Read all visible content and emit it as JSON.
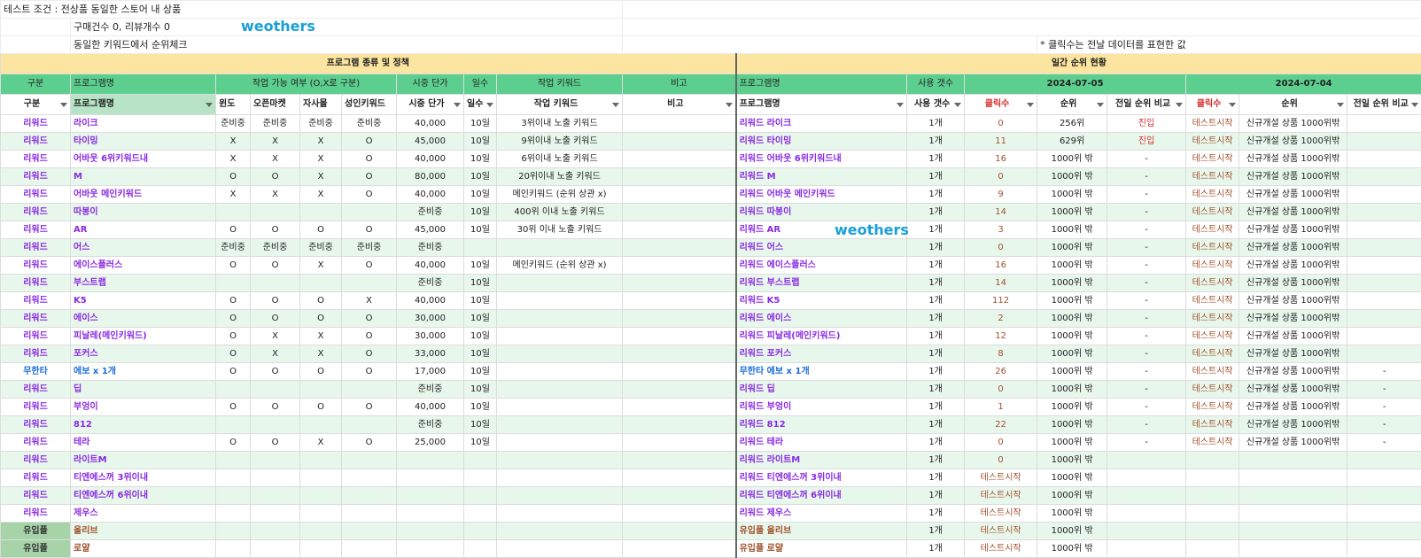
{
  "intro": {
    "line1": "테스트 조건 : 전상품 동일한 스토어 내 상품",
    "line2": "구매건수 0, 리뷰개수 0",
    "line3": "동일한 키워드에서 순위체크",
    "note": "* 클릭수는 전날 데이터를 표현한 값"
  },
  "watermark": "weothers",
  "sections": {
    "left": "프로그램 종류 및 정책",
    "right": "일간 순위 현황"
  },
  "header1": {
    "cat": "구분",
    "name": "프로그램명",
    "avail": "작업 가능 여부 (O,X로 구분)",
    "price": "시중 단가",
    "days": "일수",
    "kw": "작업 키워드",
    "memo": "비고",
    "rname": "프로그램명",
    "count": "사용 갯수",
    "date1": "2024-07-05",
    "date2": "2024-07-04"
  },
  "header2": {
    "cat": "구분",
    "name": "프로그램명",
    "wind": "윈도",
    "open": "오픈마켓",
    "own": "자사몰",
    "adult": "성인키워드",
    "price": "시중 단가",
    "days": "일수",
    "kw": "작업 키워드",
    "memo": "비고",
    "rname": "프로그램명",
    "count": "사용 갯수",
    "clicks1": "클릭수",
    "rank1": "순위",
    "cmp1": "전일 순위 비교",
    "clicks2": "클릭수",
    "rank2": "순위",
    "cmp2": "전일 순위 비교"
  },
  "rows": [
    {
      "cat": "리워드",
      "name": "라이크",
      "w": "준비중",
      "o": "준비중",
      "s": "준비중",
      "a": "준비중",
      "price": "40,000",
      "days": "10일",
      "kw": "3위이내 노출 키워드",
      "memo": "",
      "rname": "리워드 라이크",
      "count": "1개",
      "clicks": "0",
      "rank": "256위",
      "cmp": "진입",
      "c2": "테스트시작",
      "r2": "신규개설 상품 1000위밖",
      "p2": ""
    },
    {
      "cat": "리워드",
      "name": "타이밍",
      "w": "X",
      "o": "X",
      "s": "X",
      "a": "O",
      "price": "45,000",
      "days": "10일",
      "kw": "9위이내 노출 키워드",
      "memo": "",
      "rname": "리워드 타이밍",
      "count": "1개",
      "clicks": "11",
      "rank": "629위",
      "cmp": "진입",
      "c2": "테스트시작",
      "r2": "신규개설 상품 1000위밖",
      "p2": ""
    },
    {
      "cat": "리워드",
      "name": "어바웃 6위키워드내",
      "w": "X",
      "o": "X",
      "s": "X",
      "a": "O",
      "price": "40,000",
      "days": "10일",
      "kw": "6위이내 노출 키워드",
      "memo": "",
      "rname": "리워드 어바웃 6위키워드내",
      "count": "1개",
      "clicks": "16",
      "rank": "1000위 밖",
      "cmp": "-",
      "c2": "테스트시작",
      "r2": "신규개설 상품 1000위밖",
      "p2": ""
    },
    {
      "cat": "리워드",
      "name": "M",
      "w": "O",
      "o": "O",
      "s": "X",
      "a": "O",
      "price": "80,000",
      "days": "10일",
      "kw": "20위이내 노출 키워드",
      "memo": "",
      "rname": "리워드 M",
      "count": "1개",
      "clicks": "0",
      "rank": "1000위 밖",
      "cmp": "-",
      "c2": "테스트시작",
      "r2": "신규개설 상품 1000위밖",
      "p2": ""
    },
    {
      "cat": "리워드",
      "name": "어바웃 메인키워드",
      "w": "X",
      "o": "X",
      "s": "X",
      "a": "O",
      "price": "40,000",
      "days": "10일",
      "kw": "메인키워드 (순위 상관 x)",
      "memo": "",
      "rname": "리워드 어바웃 메인키워드",
      "count": "1개",
      "clicks": "9",
      "rank": "1000위 밖",
      "cmp": "-",
      "c2": "테스트시작",
      "r2": "신규개설 상품 1000위밖",
      "p2": ""
    },
    {
      "cat": "리워드",
      "name": "따봉이",
      "w": "",
      "o": "",
      "s": "",
      "a": "",
      "price": "준비중",
      "days": "10일",
      "kw": "400위 이내 노출 키워드",
      "memo": "",
      "rname": "리워드 따봉이",
      "count": "1개",
      "clicks": "14",
      "rank": "1000위 밖",
      "cmp": "-",
      "c2": "테스트시작",
      "r2": "신규개설 상품 1000위밖",
      "p2": ""
    },
    {
      "cat": "리워드",
      "name": "AR",
      "w": "O",
      "o": "O",
      "s": "O",
      "a": "O",
      "price": "45,000",
      "days": "10일",
      "kw": "30위 이내 노출 키워드",
      "memo": "",
      "rname": "리워드 AR",
      "count": "1개",
      "clicks": "3",
      "rank": "1000위 밖",
      "cmp": "-",
      "c2": "테스트시작",
      "r2": "신규개설 상품 1000위밖",
      "p2": ""
    },
    {
      "cat": "리워드",
      "name": "어스",
      "w": "준비중",
      "o": "준비중",
      "s": "준비중",
      "a": "준비중",
      "price": "준비중",
      "days": "",
      "kw": "",
      "memo": "",
      "rname": "리워드 어스",
      "count": "1개",
      "clicks": "0",
      "rank": "1000위 밖",
      "cmp": "-",
      "c2": "테스트시작",
      "r2": "신규개설 상품 1000위밖",
      "p2": ""
    },
    {
      "cat": "리워드",
      "name": "에이스플러스",
      "w": "O",
      "o": "O",
      "s": "X",
      "a": "O",
      "price": "40,000",
      "days": "10일",
      "kw": "메인키워드 (순위 상관 x)",
      "memo": "",
      "rname": "리워드 에이스플러스",
      "count": "1개",
      "clicks": "16",
      "rank": "1000위 밖",
      "cmp": "-",
      "c2": "테스트시작",
      "r2": "신규개설 상품 1000위밖",
      "p2": ""
    },
    {
      "cat": "리워드",
      "name": "부스트랩",
      "w": "",
      "o": "",
      "s": "",
      "a": "",
      "price": "준비중",
      "days": "10일",
      "kw": "",
      "memo": "",
      "rname": "리워드 부스트랩",
      "count": "1개",
      "clicks": "14",
      "rank": "1000위 밖",
      "cmp": "-",
      "c2": "테스트시작",
      "r2": "신규개설 상품 1000위밖",
      "p2": ""
    },
    {
      "cat": "리워드",
      "name": "K5",
      "w": "O",
      "o": "O",
      "s": "O",
      "a": "X",
      "price": "40,000",
      "days": "10일",
      "kw": "",
      "memo": "",
      "rname": "리워드 K5",
      "count": "1개",
      "clicks": "112",
      "rank": "1000위 밖",
      "cmp": "-",
      "c2": "테스트시작",
      "r2": "신규개설 상품 1000위밖",
      "p2": ""
    },
    {
      "cat": "리워드",
      "name": "에이스",
      "w": "O",
      "o": "O",
      "s": "O",
      "a": "O",
      "price": "30,000",
      "days": "10일",
      "kw": "",
      "memo": "",
      "rname": "리워드 에이스",
      "count": "1개",
      "clicks": "2",
      "rank": "1000위 밖",
      "cmp": "-",
      "c2": "테스트시작",
      "r2": "신규개설 상품 1000위밖",
      "p2": ""
    },
    {
      "cat": "리워드",
      "name": "피날레(메인키워드)",
      "w": "O",
      "o": "X",
      "s": "X",
      "a": "O",
      "price": "30,000",
      "days": "10일",
      "kw": "",
      "memo": "",
      "rname": "리워드 피날레(메인키워드)",
      "count": "1개",
      "clicks": "12",
      "rank": "1000위 밖",
      "cmp": "-",
      "c2": "테스트시작",
      "r2": "신규개설 상품 1000위밖",
      "p2": ""
    },
    {
      "cat": "리워드",
      "name": "포커스",
      "w": "O",
      "o": "X",
      "s": "X",
      "a": "O",
      "price": "33,000",
      "days": "10일",
      "kw": "",
      "memo": "",
      "rname": "리워드 포커스",
      "count": "1개",
      "clicks": "8",
      "rank": "1000위 밖",
      "cmp": "-",
      "c2": "테스트시작",
      "r2": "신규개설 상품 1000위밖",
      "p2": ""
    },
    {
      "cat": "무한타",
      "name": "에보 x 1개",
      "w": "O",
      "o": "O",
      "s": "O",
      "a": "O",
      "price": "17,000",
      "days": "10일",
      "kw": "",
      "memo": "",
      "rname": "무한타 에보 x 1개",
      "count": "1개",
      "clicks": "26",
      "rank": "1000위 밖",
      "cmp": "-",
      "c2": "테스트시작",
      "r2": "신규개설 상품 1000위밖",
      "p2": "-",
      "inf": true
    },
    {
      "cat": "리워드",
      "name": "딥",
      "w": "",
      "o": "",
      "s": "",
      "a": "",
      "price": "준비중",
      "days": "10일",
      "kw": "",
      "memo": "",
      "rname": "리워드 딥",
      "count": "1개",
      "clicks": "0",
      "rank": "1000위 밖",
      "cmp": "-",
      "c2": "테스트시작",
      "r2": "신규개설 상품 1000위밖",
      "p2": "-"
    },
    {
      "cat": "리워드",
      "name": "부엉이",
      "w": "O",
      "o": "O",
      "s": "O",
      "a": "O",
      "price": "40,000",
      "days": "10일",
      "kw": "",
      "memo": "",
      "rname": "리워드 부엉이",
      "count": "1개",
      "clicks": "1",
      "rank": "1000위 밖",
      "cmp": "-",
      "c2": "테스트시작",
      "r2": "신규개설 상품 1000위밖",
      "p2": "-"
    },
    {
      "cat": "리워드",
      "name": "812",
      "w": "",
      "o": "",
      "s": "",
      "a": "",
      "price": "준비중",
      "days": "10일",
      "kw": "",
      "memo": "",
      "rname": "리워드 812",
      "count": "1개",
      "clicks": "22",
      "rank": "1000위 밖",
      "cmp": "-",
      "c2": "테스트시작",
      "r2": "신규개설 상품 1000위밖",
      "p2": "-"
    },
    {
      "cat": "리워드",
      "name": "테라",
      "w": "O",
      "o": "O",
      "s": "X",
      "a": "O",
      "price": "25,000",
      "days": "10일",
      "kw": "",
      "memo": "",
      "rname": "리워드 테라",
      "count": "1개",
      "clicks": "0",
      "rank": "1000위 밖",
      "cmp": "-",
      "c2": "테스트시작",
      "r2": "신규개설 상품 1000위밖",
      "p2": "-"
    },
    {
      "cat": "리워드",
      "name": "라이트M",
      "w": "",
      "o": "",
      "s": "",
      "a": "",
      "price": "",
      "days": "",
      "kw": "",
      "memo": "",
      "rname": "리워드 라이트M",
      "count": "1개",
      "clicks": "0",
      "rank": "1000위 밖",
      "cmp": "",
      "c2": "",
      "r2": "",
      "p2": ""
    },
    {
      "cat": "리워드",
      "name": "티엔에스꺼 3위이내",
      "w": "",
      "o": "",
      "s": "",
      "a": "",
      "price": "",
      "days": "",
      "kw": "",
      "memo": "",
      "rname": "리워드 티엔에스꺼 3위이내",
      "count": "1개",
      "clicks": "테스트시작",
      "rank": "1000위 밖",
      "cmp": "",
      "c2": "",
      "r2": "",
      "p2": ""
    },
    {
      "cat": "리워드",
      "name": "티엔에스꺼 6위이내",
      "w": "",
      "o": "",
      "s": "",
      "a": "",
      "price": "",
      "days": "",
      "kw": "",
      "memo": "",
      "rname": "리워드 티엔에스꺼 6위이내",
      "count": "1개",
      "clicks": "테스트시작",
      "rank": "1000위 밖",
      "cmp": "",
      "c2": "",
      "r2": "",
      "p2": ""
    },
    {
      "cat": "리워드",
      "name": "제우스",
      "w": "",
      "o": "",
      "s": "",
      "a": "",
      "price": "",
      "days": "",
      "kw": "",
      "memo": "",
      "rname": "리워드 제우스",
      "count": "1개",
      "clicks": "테스트시작",
      "rank": "1000위 밖",
      "cmp": "",
      "c2": "",
      "r2": "",
      "p2": ""
    },
    {
      "cat": "유입플",
      "name": "올리브",
      "w": "",
      "o": "",
      "s": "",
      "a": "",
      "price": "",
      "days": "",
      "kw": "",
      "memo": "",
      "rname": "유입플 올리브",
      "count": "1개",
      "clicks": "테스트시작",
      "rank": "1000위 밖",
      "cmp": "",
      "c2": "",
      "r2": "",
      "p2": "",
      "yp": true
    },
    {
      "cat": "유입플",
      "name": "로얄",
      "w": "",
      "o": "",
      "s": "",
      "a": "",
      "price": "",
      "days": "",
      "kw": "",
      "memo": "",
      "rname": "유입플 로얄",
      "count": "1개",
      "clicks": "테스트시작",
      "rank": "1000위 밖",
      "cmp": "",
      "c2": "",
      "r2": "",
      "p2": "",
      "yp": true
    }
  ]
}
